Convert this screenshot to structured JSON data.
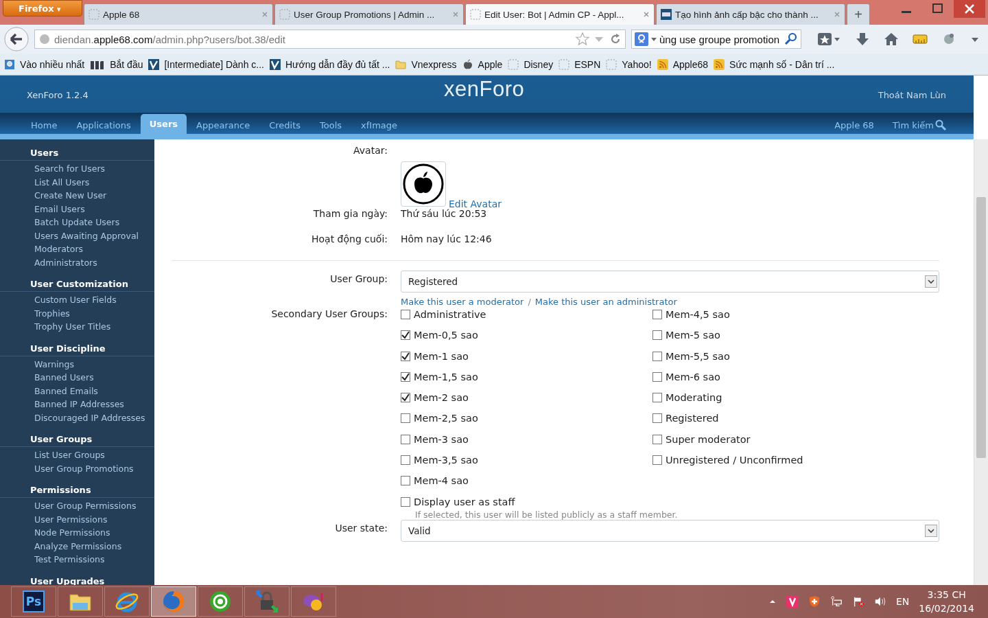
{
  "browser": {
    "menu_button": "Firefox",
    "menu_caret": "▾",
    "tabs": [
      {
        "title": "Apple 68",
        "selected": false,
        "kind": "blank"
      },
      {
        "title": "User Group Promotions | Admin ...",
        "selected": false,
        "kind": "blank"
      },
      {
        "title": "Edit User: Bot | Admin CP - Appl...",
        "selected": true,
        "kind": "blank"
      },
      {
        "title": "Tạo hình ảnh cấp bậc cho thành ...",
        "selected": false,
        "kind": "site"
      }
    ],
    "new_tab": "+",
    "address": {
      "prefix": "diendan.",
      "domain": "apple68.com",
      "path": "/admin.php?users/bot.38/edit"
    },
    "search": {
      "value": "ùng use groupe promotion"
    },
    "bookmarks": [
      {
        "label": "Vào nhiều nhất",
        "kind": "smart"
      },
      {
        "label": "Bắt đầu",
        "kind": "m"
      },
      {
        "label": "[Intermediate] Dành c...",
        "kind": "v"
      },
      {
        "label": "Hướng dẫn đầy đủ tất ...",
        "kind": "v"
      },
      {
        "label": "Vnexpress",
        "kind": "folder"
      },
      {
        "label": "Apple",
        "kind": "apple"
      },
      {
        "label": "Disney",
        "kind": "blank"
      },
      {
        "label": "ESPN",
        "kind": "blank"
      },
      {
        "label": "Yahoo!",
        "kind": "blank"
      },
      {
        "label": "Apple68",
        "kind": "feed"
      },
      {
        "label": "Sức mạnh số - Dân trí ...",
        "kind": "feed"
      }
    ]
  },
  "header": {
    "version": "XenForo 1.2.4",
    "logo": "xenForo",
    "account_link": "Thoát Nam Lùn",
    "tabs": [
      {
        "label": "Home",
        "selected": false
      },
      {
        "label": "Applications",
        "selected": false
      },
      {
        "label": "Users",
        "selected": true
      },
      {
        "label": "Appearance",
        "selected": false
      },
      {
        "label": "Credits",
        "selected": false
      },
      {
        "label": "Tools",
        "selected": false
      },
      {
        "label": "xfImage",
        "selected": false
      }
    ],
    "right_links": [
      "Apple 68",
      "Tìm kiếm"
    ]
  },
  "sidebar": {
    "sections": [
      {
        "heading": "Users",
        "items": [
          "Search for Users",
          "List All Users",
          "Create New User",
          "Email Users",
          "Batch Update Users",
          "Users Awaiting Approval",
          "Moderators",
          "Administrators"
        ]
      },
      {
        "heading": "User Customization",
        "items": [
          "Custom User Fields",
          "Trophies",
          "Trophy User Titles"
        ]
      },
      {
        "heading": "User Discipline",
        "items": [
          "Warnings",
          "Banned Users",
          "Banned Emails",
          "Banned IP Addresses",
          "Discouraged IP Addresses"
        ]
      },
      {
        "heading": "User Groups",
        "items": [
          "List User Groups",
          "User Group Promotions"
        ]
      },
      {
        "heading": "Permissions",
        "items": [
          "User Group Permissions",
          "User Permissions",
          "Node Permissions",
          "Analyze Permissions",
          "Test Permissions"
        ]
      },
      {
        "heading": "User Upgrades"
      }
    ]
  },
  "form": {
    "avatar": {
      "label": "Avatar:",
      "link": "Edit Avatar"
    },
    "joined": {
      "label": "Tham gia ngày:",
      "value": "Thứ sáu lúc 20:53"
    },
    "last_activity": {
      "label": "Hoạt động cuối:",
      "value": "Hôm nay lúc 12:46"
    },
    "user_group": {
      "label": "User Group:",
      "value": "Registered",
      "links": [
        "Make this user a moderator",
        "Make this user an administrator"
      ],
      "separator": "/"
    },
    "secondary_groups": {
      "label": "Secondary User Groups:",
      "options": [
        {
          "label": "Administrative",
          "checked": false
        },
        {
          "label": "Mem-0,5 sao",
          "checked": true
        },
        {
          "label": "Mem-1 sao",
          "checked": true
        },
        {
          "label": "Mem-1,5 sao",
          "checked": true
        },
        {
          "label": "Mem-2 sao",
          "checked": true
        },
        {
          "label": "Mem-2,5 sao",
          "checked": false
        },
        {
          "label": "Mem-3 sao",
          "checked": false
        },
        {
          "label": "Mem-3,5 sao",
          "checked": false
        },
        {
          "label": "Mem-4 sao",
          "checked": false
        },
        {
          "label": "Mem-4,5 sao",
          "checked": false
        },
        {
          "label": "Mem-5 sao",
          "checked": false
        },
        {
          "label": "Mem-5,5 sao",
          "checked": false
        },
        {
          "label": "Mem-6 sao",
          "checked": false
        },
        {
          "label": "Moderating",
          "checked": false
        },
        {
          "label": "Registered",
          "checked": false
        },
        {
          "label": "Super moderator",
          "checked": false
        },
        {
          "label": "Unregistered / Unconfirmed",
          "checked": false
        }
      ]
    },
    "staff": {
      "label": "Display user as staff",
      "checked": false,
      "hint": "If selected, this user will be listed publicly as a staff member."
    },
    "user_state": {
      "label": "User state:",
      "value": "Valid"
    }
  },
  "taskbar": {
    "apps": [
      {
        "kind": "photoshop",
        "label": "Ps",
        "selected": false
      },
      {
        "kind": "explorer",
        "selected": false
      },
      {
        "kind": "ie",
        "selected": false
      },
      {
        "kind": "firefox",
        "selected": true
      },
      {
        "kind": "coccoc",
        "selected": false
      },
      {
        "kind": "vpn",
        "selected": false
      },
      {
        "kind": "yahoo",
        "selected": false
      }
    ],
    "language": "EN",
    "time": "3:35 CH",
    "date": "16/02/2014"
  }
}
